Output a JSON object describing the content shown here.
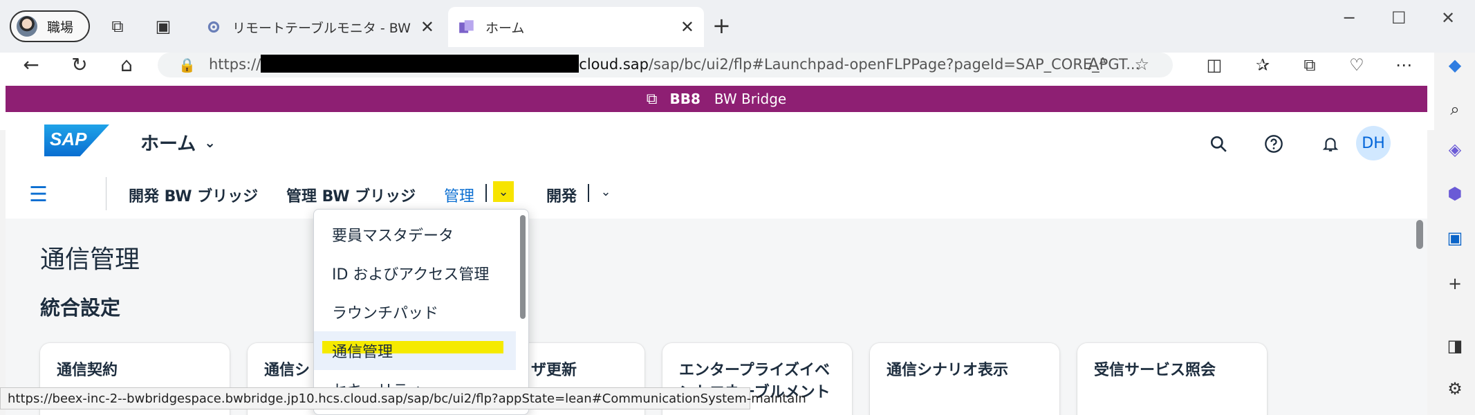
{
  "browser": {
    "profile_label": "職場",
    "tabs": [
      {
        "title": "リモートテーブルモニタ - BW Bridge (S",
        "active": false
      },
      {
        "title": "ホーム",
        "active": true
      }
    ],
    "new_tab": "+",
    "close_glyph": "✕",
    "window_controls": {
      "minimize": "─",
      "maximize": "☐",
      "close": "✕"
    },
    "url_prefix": "https://",
    "url_host": "cloud.sap",
    "url_path": "/sap/bc/ui2/flp#Launchpad-openFLPPage?pageId=SAP_CORE_PGT...",
    "read_aloud": "Aᴬ",
    "status_url": "https://beex-inc-2--bwbridgespace.bwbridge.jp10.hcs.cloud.sap/sap/bc/ui2/flp?appState=lean#CommunicationSystem-maintain"
  },
  "space": {
    "system_id": "BB8",
    "name": "BW Bridge"
  },
  "shell": {
    "logo": "SAP",
    "title": "ホーム",
    "user_initials": "DH"
  },
  "pagebar": {
    "items": [
      "開発 BW ブリッジ",
      "管理 BW ブリッジ",
      "管理",
      "開発"
    ]
  },
  "dropdown": {
    "items": [
      "要員マスタデータ",
      "ID およびアクセス管理",
      "ラウンチパッド",
      "通信管理",
      "セキュリティ"
    ],
    "selected_index": 3
  },
  "content": {
    "page_title": "通信管理",
    "section_title": "統合設定",
    "tiles": [
      "通信契約",
      "通信シ",
      "ザ更新",
      "エンタープライズイベントエネーブルメント",
      "通信シナリオ表示",
      "受信サービス照会"
    ]
  },
  "colors": {
    "space_band": "#8e1f73",
    "accent": "#0a6ed1",
    "highlight": "#f5ea00"
  }
}
